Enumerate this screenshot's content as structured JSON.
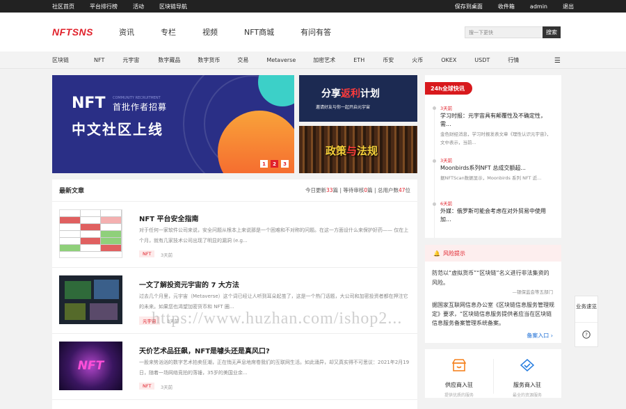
{
  "topbar": {
    "left": [
      "社区首页",
      "平台排行榜",
      "活动",
      "区块链导航"
    ],
    "right": [
      "保存到桌面",
      "收件箱",
      "admin",
      "退出"
    ]
  },
  "header": {
    "logo": "NFTSNS",
    "nav": [
      "资讯",
      "专栏",
      "视频",
      "NFT商城",
      "有问有答"
    ],
    "search_placeholder": "搜一下更快",
    "search_button": "搜索"
  },
  "categories": [
    "区块链",
    "NFT",
    "元宇宙",
    "数字藏品",
    "数字货币",
    "交易",
    "Metaverse",
    "加密艺术",
    "ETH",
    "币安",
    "火币",
    "OKEX",
    "USDT",
    "行情"
  ],
  "banner": {
    "nft": "NFT",
    "recruit": "首批作者招募",
    "community": "COMMUNITY RECRUITMENT",
    "headline": "中文社区上线",
    "dots": [
      "1",
      "2",
      "3"
    ],
    "active_dot": 1
  },
  "promo1": {
    "a": "分享",
    "b": "返利",
    "c": "计划",
    "sub": "邀请好友与你一起开启元宇宙"
  },
  "promo2": {
    "a": "政策",
    "b": "与",
    "c": "法规"
  },
  "latest": {
    "title": "最新文章",
    "stats_pre": "今日更新",
    "today": "33",
    "stats_mid1": "篇 | 等待审核",
    "pending": "0",
    "stats_mid2": "篇 | 总用户数",
    "users": "47",
    "stats_post": "位"
  },
  "articles": [
    {
      "title": "NFT 平台安全指南",
      "desc": "对于任何一家软件公司来说，安全问题从根本上来说那是一个困难和不对称的问题。在这一方面设什么来保护好药—— 仅在上个月，就有几家技术公司出现了明显的漏洞 (e.g...",
      "tag": "NFT",
      "time": "3天前"
    },
    {
      "title": "一文了解投资元宇宙的 7 大方法",
      "desc": "过去几个月里，元宇宙（Metaverse）这个词已经让人听到耳朵起茧了，这是一个热门话题，大公司和加密投资者都在押注它的未来。如果您也渴望加密货币和 NFT 圈...",
      "tag": "元宇宙",
      "time": "3天前"
    },
    {
      "title": "天价艺术品狂飙，NFT是噱头还是真风口?",
      "desc": "一股来势汹汹的数字艺术拍卖狂潮，正在悄无声息地席卷我们的互联网生活。如此涌异，却又真实得不可思议：2021年2月19日，随着一场网络竞拍的落锤，35岁的美国业余...",
      "tag": "NFT",
      "time": "3天前"
    }
  ],
  "news": {
    "badge": "24h全球快讯",
    "items": [
      {
        "date": "3天前",
        "title": "学习时报：元宇宙具有颠覆性及不确定性，需...",
        "summary": "金色财经消息，学习时报发表文章《理性认识元宇宙》，文中表示，当前..."
      },
      {
        "date": "3天前",
        "title": "Moonbirds系列NFT 总成交额超...",
        "summary": "据NFTScan数据显示，Moonbirds 系列 NFT 近..."
      },
      {
        "date": "6天前",
        "title": "外媒：俄罗斯可能会考虑在对外贸易中使用加...",
        "summary": ""
      }
    ]
  },
  "risk": {
    "title": "风险提示",
    "p1": "防范以“虚拟货币”“区块链”名义进行非法集资的风险。",
    "src": "—银保监会等五部门",
    "p2": "据国家互联网信息办公室《区块链信息服务管理规定》要求，“区块链信息服务提供者应当在区块链信息服务备案管理系统备案。",
    "more": "备案入口"
  },
  "services": [
    {
      "label": "供应商入驻",
      "sub": "提供优质的服务"
    },
    {
      "label": "服务商入驻",
      "sub": "最全的资源服务"
    }
  ],
  "float": {
    "label": "业务速览"
  },
  "watermark": "https://www.huzhan.com/ishop2..."
}
